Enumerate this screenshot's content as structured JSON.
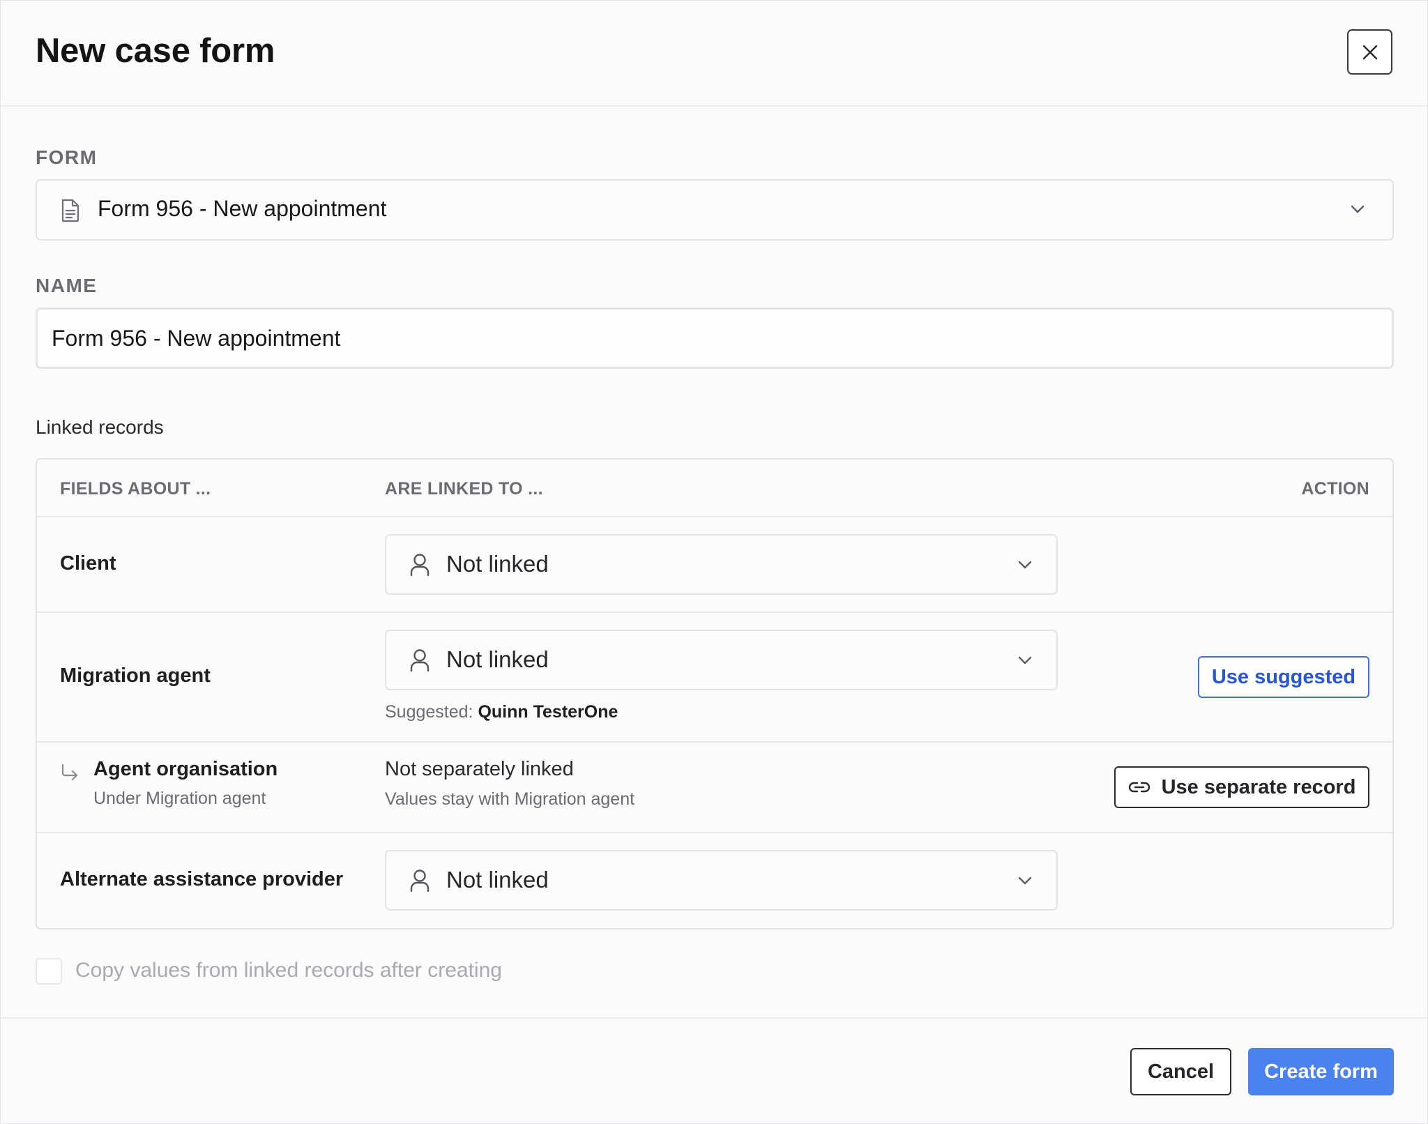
{
  "dialog": {
    "title": "New case form"
  },
  "form_section": {
    "label": "FORM",
    "selected": "Form 956 - New appointment"
  },
  "name_section": {
    "label": "NAME",
    "value": "Form 956 - New appointment"
  },
  "linked_records": {
    "heading": "Linked records",
    "columns": {
      "fields_about": "FIELDS ABOUT ...",
      "linked_to": "ARE LINKED TO ...",
      "action": "ACTION"
    },
    "rows": [
      {
        "field": "Client",
        "linked_value": "Not linked"
      },
      {
        "field": "Migration agent",
        "linked_value": "Not linked",
        "suggested_prefix": "Suggested:",
        "suggested_name": "Quinn TesterOne",
        "action_label": "Use suggested"
      },
      {
        "field": "Agent organisation",
        "field_sub": "Under Migration agent",
        "linked_value": "Not separately linked",
        "linked_sub": "Values stay with Migration agent",
        "action_label": "Use separate record"
      },
      {
        "field": "Alternate assistance provider",
        "linked_value": "Not linked"
      }
    ]
  },
  "copy_values": {
    "label": "Copy values from linked records after creating",
    "checked": false
  },
  "footer": {
    "cancel_label": "Cancel",
    "create_label": "Create form"
  },
  "colors": {
    "primary": "#4a82ef",
    "link_blue": "#2755d3",
    "muted_text": "#6b6c72",
    "border": "#e3e4e8"
  }
}
